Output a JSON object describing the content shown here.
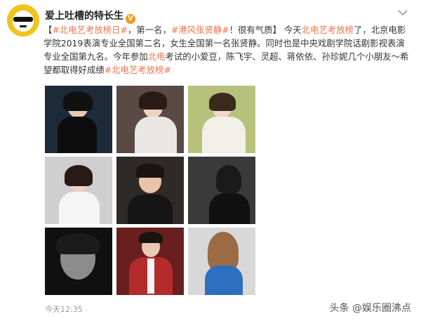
{
  "post": {
    "username": "爱上吐槽的特长生",
    "verified_badge": "V",
    "timestamp": "今天12:35",
    "watermark": "头条 @娱乐圈沸点",
    "content": {
      "t1": "#北电艺考放榜日#",
      "t2": "，第一名，",
      "t3": "#港风张贤静#",
      "t4": "！很有气质】 今天",
      "t5": "北电艺考放榜",
      "t6": "了，北京电影学院2019表演专业全国第二名，女生全国第一名张贤静。同时也是中央戏剧学院话剧影视表演专业全国第九名。今年参加",
      "t7": "北电",
      "t8": "考试的小爱豆，陈飞宇、灵超、蒋依依、孙珍妮几个小朋友～希望都取得好成绩",
      "t9": "#北电艺考放榜#",
      "prefix": "【"
    },
    "icons": {
      "avatar": "avatar-icon",
      "menu": "chevron-down-icon"
    }
  }
}
